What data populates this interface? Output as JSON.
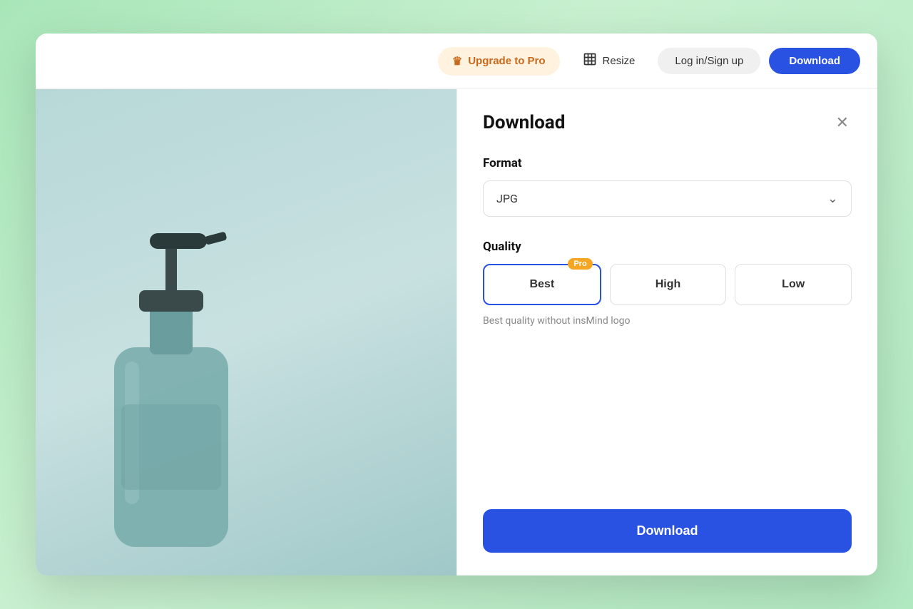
{
  "toolbar": {
    "upgrade_label": "Upgrade to Pro",
    "resize_label": "Resize",
    "login_label": "Log in/Sign up",
    "download_label": "Download"
  },
  "panel": {
    "title": "Download",
    "close_icon": "✕",
    "format_section_label": "Format",
    "format_value": "JPG",
    "quality_section_label": "Quality",
    "quality_options": [
      {
        "label": "Best",
        "badge": "Pro",
        "selected": true
      },
      {
        "label": "High",
        "badge": null,
        "selected": false
      },
      {
        "label": "Low",
        "badge": null,
        "selected": false
      }
    ],
    "quality_description": "Best quality without insMind logo",
    "download_button_label": "Download"
  },
  "icons": {
    "crown": "♛",
    "resize": "⊡",
    "chevron_down": "⌄"
  }
}
